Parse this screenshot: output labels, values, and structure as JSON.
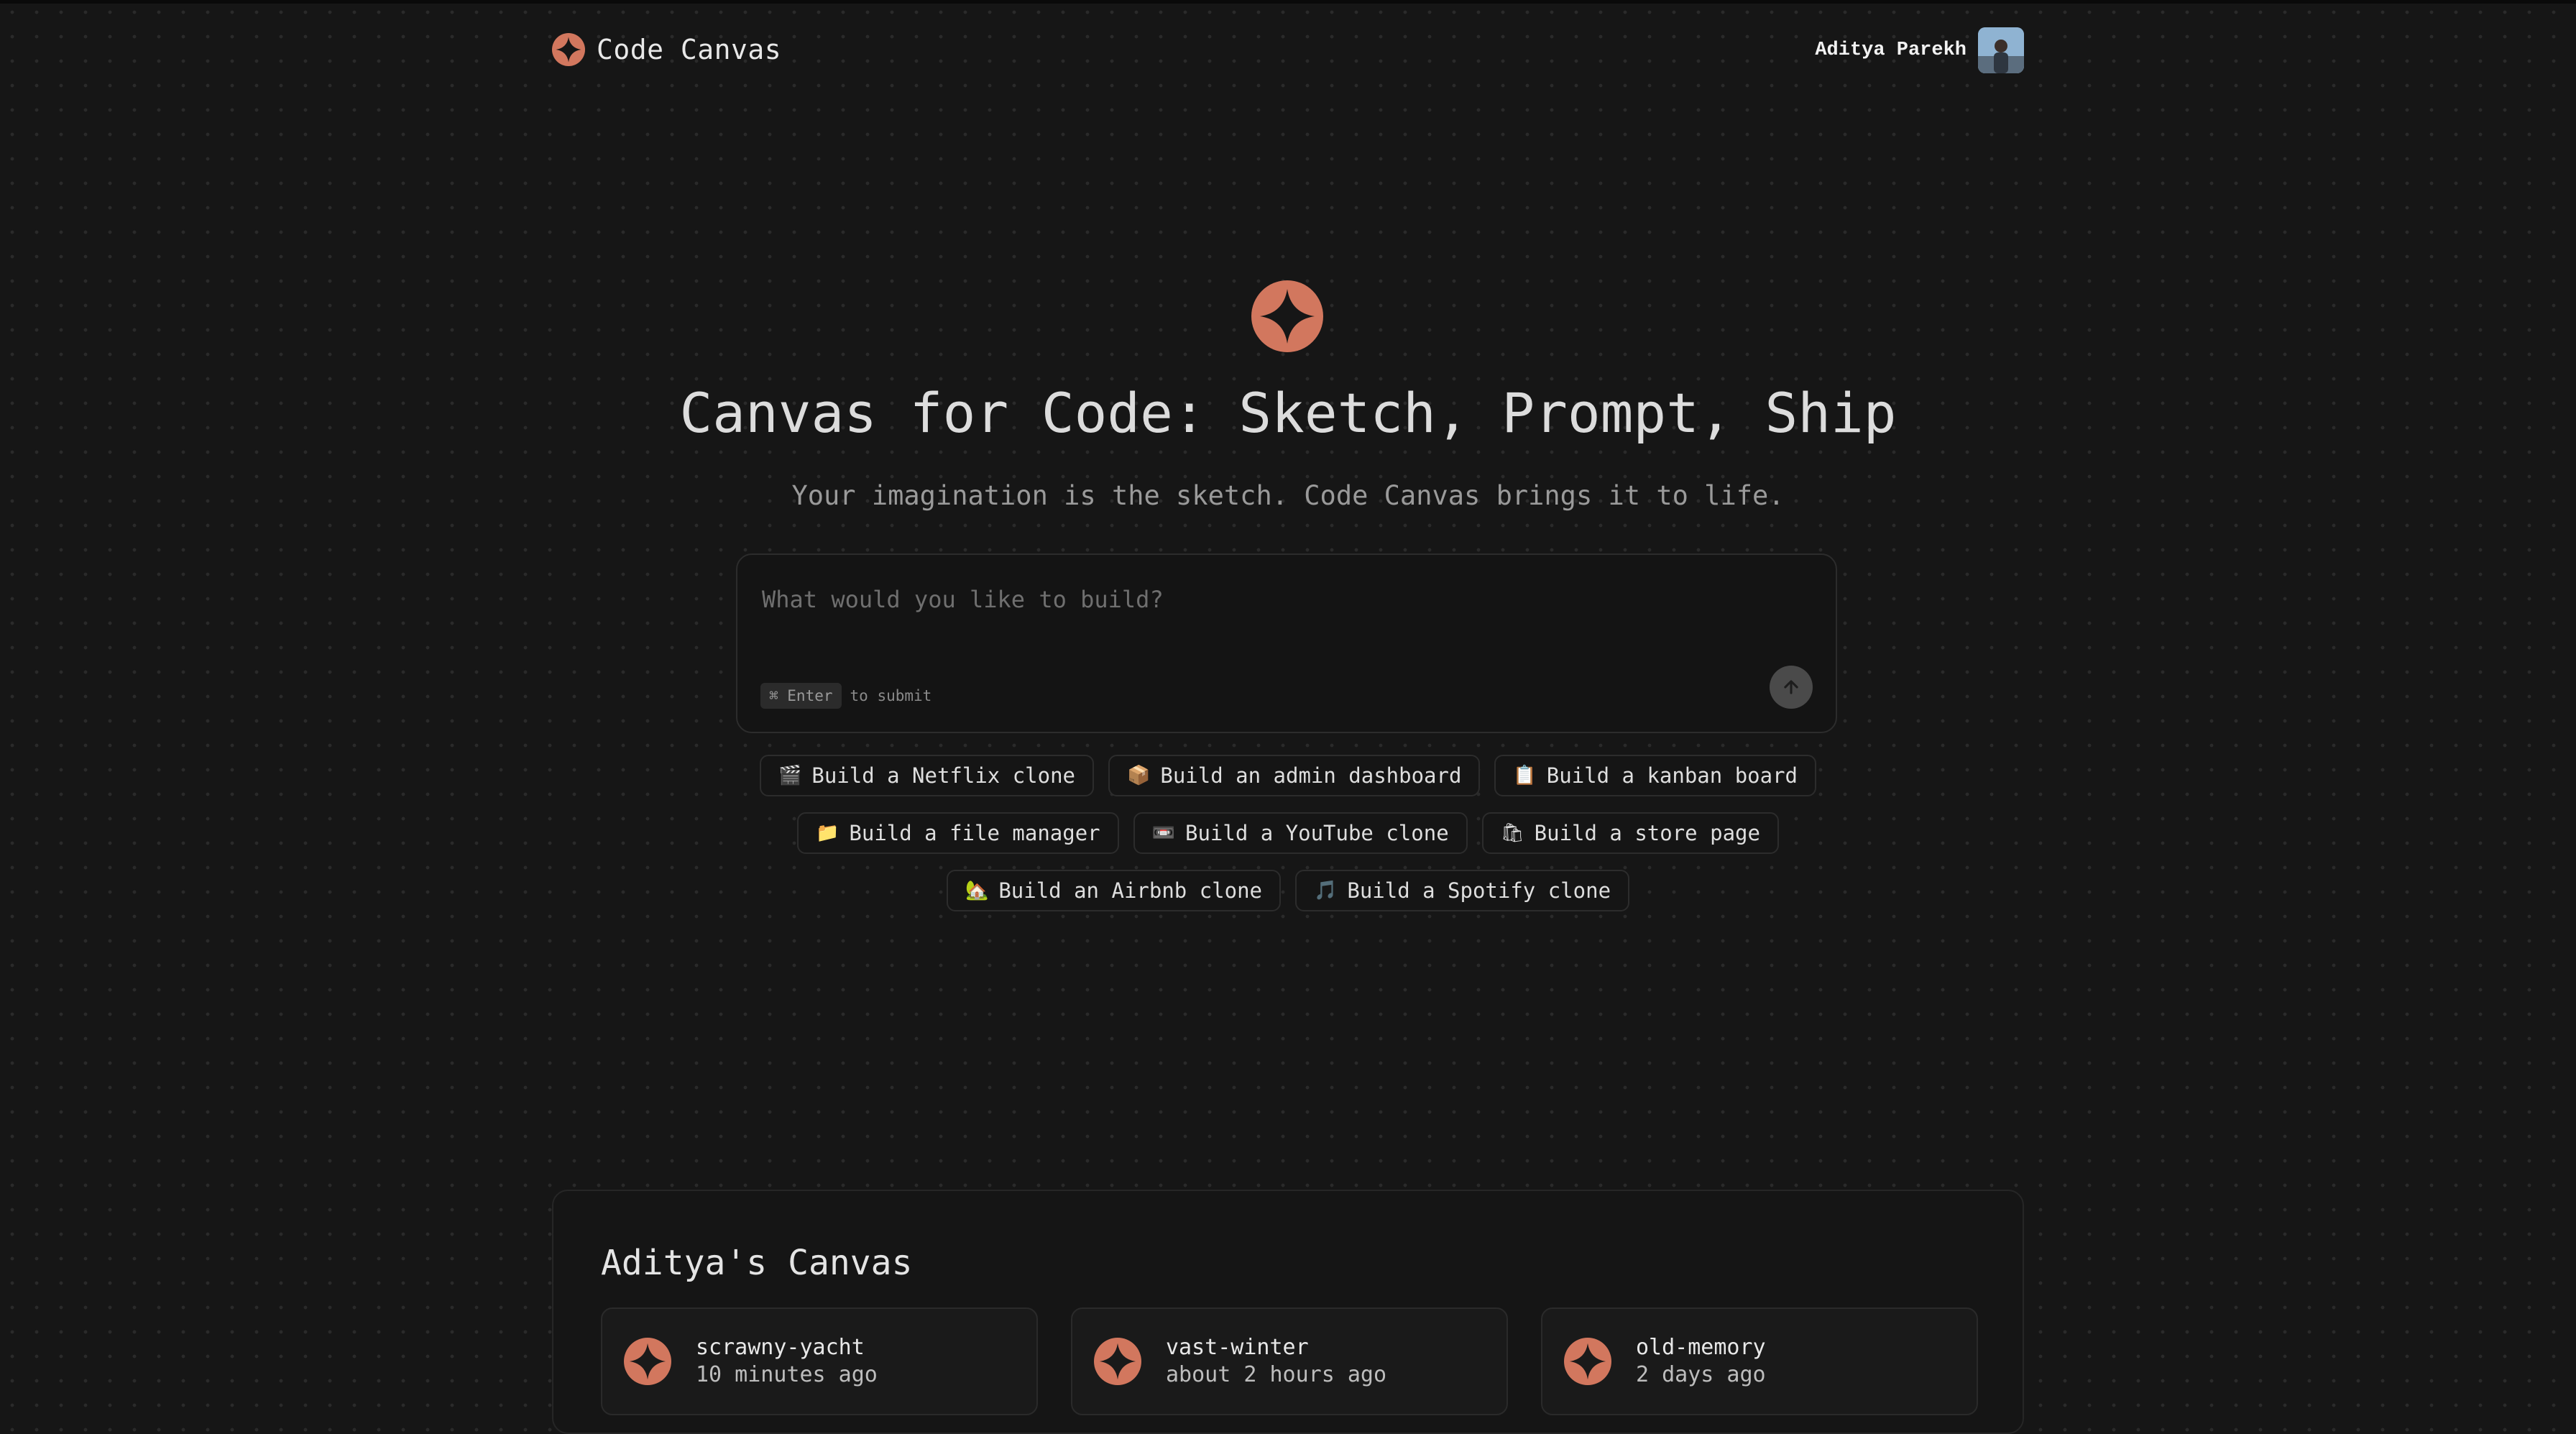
{
  "header": {
    "app_name": "Code Canvas",
    "user_name": "Aditya Parekh"
  },
  "hero": {
    "title": "Canvas for Code: Sketch, Prompt, Ship",
    "subtitle": "Your imagination is the sketch. Code Canvas brings it to life."
  },
  "prompt": {
    "placeholder": "What would you like to build?",
    "value": "",
    "shortcut_key": "⌘ Enter",
    "shortcut_hint": "to submit"
  },
  "suggestions": [
    {
      "emoji": "🎬",
      "label": "Build a Netflix clone"
    },
    {
      "emoji": "📦",
      "label": "Build an admin dashboard"
    },
    {
      "emoji": "📋",
      "label": "Build a kanban board"
    },
    {
      "emoji": "📁",
      "label": "Build a file manager"
    },
    {
      "emoji": "📼",
      "label": "Build a YouTube clone"
    },
    {
      "emoji": "🛍",
      "label": "Build a store page"
    },
    {
      "emoji": "🏡",
      "label": "Build an Airbnb clone"
    },
    {
      "emoji": "🎵",
      "label": "Build a Spotify clone"
    }
  ],
  "canvas": {
    "title": "Aditya's Canvas",
    "projects": [
      {
        "name": "scrawny-yacht",
        "time": "10 minutes ago"
      },
      {
        "name": "vast-winter",
        "time": "about 2 hours ago"
      },
      {
        "name": "old-memory",
        "time": "2 days ago"
      }
    ]
  },
  "colors": {
    "background": "#161616",
    "accent": "#d2775e"
  },
  "icons": {
    "logo": "sparkle-star-logo-icon",
    "submit": "arrow-up-icon"
  }
}
